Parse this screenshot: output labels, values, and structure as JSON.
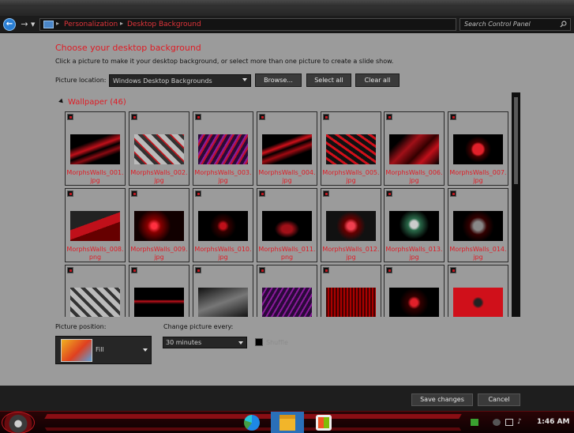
{
  "address": {
    "breadcrumb": [
      "Personalization",
      "Desktop Background"
    ],
    "search_placeholder": "Search Control Panel"
  },
  "page": {
    "heading": "Choose your desktop background",
    "subtext": "Click a picture to make it your desktop background, or select more than one picture to create a slide show.",
    "picture_location_label": "Picture location:",
    "picture_location_value": "Windows Desktop Backgrounds",
    "browse_label": "Browse...",
    "select_all_label": "Select all",
    "clear_all_label": "Clear all",
    "group_label": "Wallpaper (46)"
  },
  "wallpapers": [
    {
      "line1": "MorphsWalls_001.",
      "line2": "jpg"
    },
    {
      "line1": "MorphsWalls_002.",
      "line2": "jpg"
    },
    {
      "line1": "MorphsWalls_003.",
      "line2": "jpg"
    },
    {
      "line1": "MorphsWalls_004.",
      "line2": "jpg"
    },
    {
      "line1": "MorphsWalls_005.",
      "line2": "jpg"
    },
    {
      "line1": "MorphsWalls_006.",
      "line2": "jpg"
    },
    {
      "line1": "MorphsWalls_007.",
      "line2": "jpg"
    },
    {
      "line1": "MorphsWalls_008.",
      "line2": "png"
    },
    {
      "line1": "MorphsWalls_009.",
      "line2": "jpg"
    },
    {
      "line1": "MorphsWalls_010.",
      "line2": "jpg"
    },
    {
      "line1": "MorphsWalls_011.",
      "line2": "png"
    },
    {
      "line1": "MorphsWalls_012.",
      "line2": "jpg"
    },
    {
      "line1": "MorphsWalls_013.",
      "line2": "jpg"
    },
    {
      "line1": "MorphsWalls_014.",
      "line2": "jpg"
    }
  ],
  "options": {
    "picture_position_label": "Picture position:",
    "picture_position_value": "Fill",
    "change_every_label": "Change picture every:",
    "change_every_value": "30 minutes",
    "shuffle_label": "Shuffle"
  },
  "footer": {
    "save_label": "Save changes",
    "cancel_label": "Cancel"
  },
  "taskbar": {
    "clock": "1:46 AM"
  },
  "colors": {
    "accent_red": "#e01b24",
    "panel_gray": "#9b9b9b",
    "dark": "#1e1e1e"
  }
}
